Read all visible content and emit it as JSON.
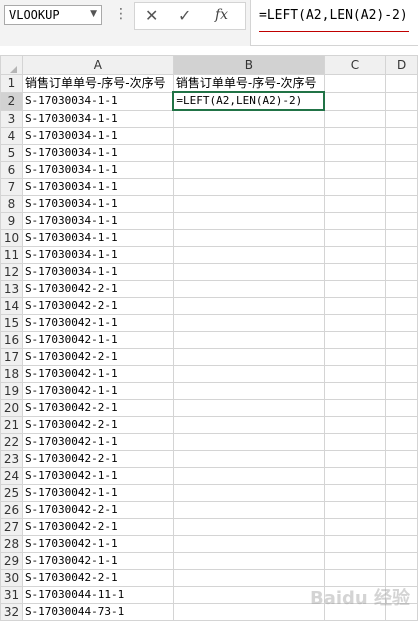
{
  "formula_bar": {
    "name_box": "VLOOKUP",
    "name_box_arrow": "▼",
    "more_icon": "⋮",
    "cancel_icon": "✕",
    "enter_icon": "✓",
    "fx_icon": "fx",
    "formula": "=LEFT(A2,LEN(A2)-2)"
  },
  "columns": [
    "A",
    "B",
    "C",
    "D"
  ],
  "header_row": {
    "a": "销售订单单号-序号-次序号",
    "b": "销售订单单号-序号-次序号"
  },
  "editing_cell_text": "=LEFT(A2,LEN(A2)-2)",
  "rows": [
    "S-17030034-1-1",
    "S-17030034-1-1",
    "S-17030034-1-1",
    "S-17030034-1-1",
    "S-17030034-1-1",
    "S-17030034-1-1",
    "S-17030034-1-1",
    "S-17030034-1-1",
    "S-17030034-1-1",
    "S-17030034-1-1",
    "S-17030034-1-1",
    "S-17030042-2-1",
    "S-17030042-2-1",
    "S-17030042-1-1",
    "S-17030042-1-1",
    "S-17030042-2-1",
    "S-17030042-1-1",
    "S-17030042-1-1",
    "S-17030042-2-1",
    "S-17030042-2-1",
    "S-17030042-1-1",
    "S-17030042-2-1",
    "S-17030042-1-1",
    "S-17030042-1-1",
    "S-17030042-2-1",
    "S-17030042-2-1",
    "S-17030042-1-1",
    "S-17030042-1-1",
    "S-17030042-2-1",
    "S-17030044-11-1",
    "S-17030044-73-1"
  ],
  "watermark": "Baidu 经验"
}
